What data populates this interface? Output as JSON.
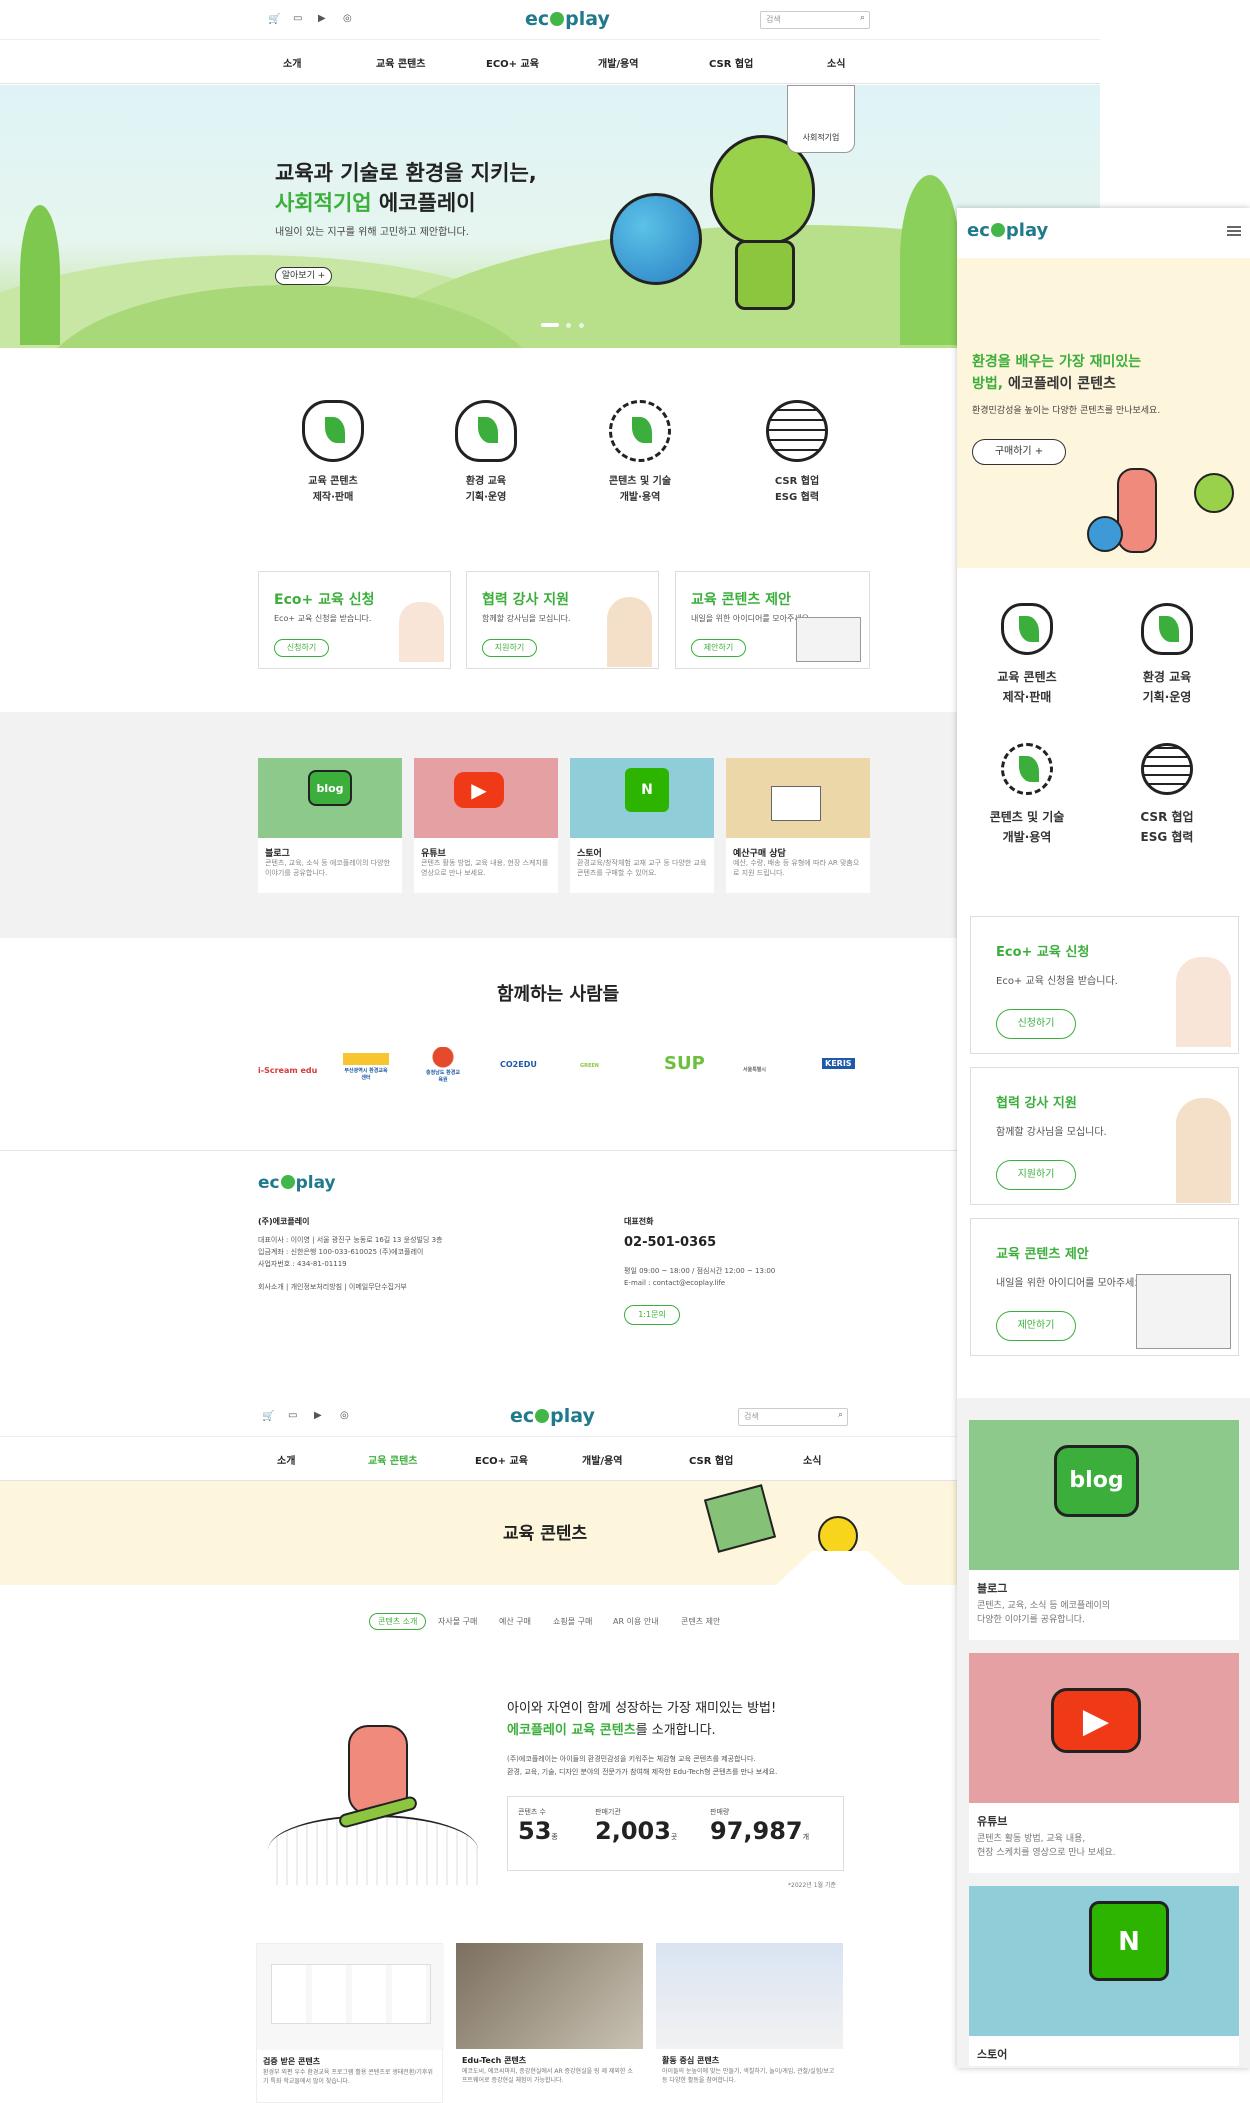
{
  "desktop": {
    "search_placeholder": "검색",
    "logo": "ecoplay",
    "nav": [
      "소개",
      "교육 콘텐츠",
      "ECO+ 교육",
      "개발/용역",
      "CSR 협업",
      "소식"
    ],
    "hero": {
      "title_line1": "교육과 기술로 환경을 지키는,",
      "title_green": "사회적기업",
      "title_rest": " 에코플레이",
      "subtitle": "내일이 있는 지구를 위해 고민하고 제안합니다.",
      "button": "알아보기 +",
      "badge": "사회적기업"
    },
    "services": [
      {
        "l1": "교육 콘텐츠",
        "l2": "제작·판매"
      },
      {
        "l1": "환경 교육",
        "l2": "기획·운영"
      },
      {
        "l1": "콘텐츠 및 기술",
        "l2": "개발·용역"
      },
      {
        "l1": "CSR 협업",
        "l2": "ESG 협력"
      }
    ],
    "cards": [
      {
        "title": "Eco+ 교육 신청",
        "desc": "Eco+ 교육 신청을 받습니다.",
        "btn": "신청하기"
      },
      {
        "title": "협력 강사 지원",
        "desc": "함께할 강사님을 모십니다.",
        "btn": "지원하기"
      },
      {
        "title": "교육 콘텐츠 제안",
        "desc": "내일을 위한 아이디어를 모아주세요.",
        "btn": "제안하기"
      }
    ],
    "channels": [
      {
        "title": "블로그",
        "desc": "콘텐츠, 교육, 소식 등 에코플레이의 다양한 이야기를 공유합니다."
      },
      {
        "title": "유튜브",
        "desc": "콘텐츠 활동 방법, 교육 내용, 현장 스케치를 영상으로 만나 보세요."
      },
      {
        "title": "스토어",
        "desc": "환경교육/창작체험 교재 교구 등 다양한 교육 콘텐츠를 구매할 수 있어요."
      },
      {
        "title": "예산구매 상담",
        "desc": "예산, 수량, 배송 등 유형에 따라 AR 맞춤으로 지원 드립니다."
      }
    ],
    "partners_title": "함께하는 사람들",
    "partners": [
      "i-Scream edu",
      "부산광역시 환경교육센터",
      "충청남도 환경교육원",
      "CO2EDU",
      "GREEN",
      "SUP",
      "서울특별시",
      "KERIS"
    ],
    "footer": {
      "company": "(주)에코플레이",
      "line1": "대표이사 : 이이영 | 서울 광진구 능동로 16길 13 윤성빌딩 3층",
      "line2": "입금계좌 : 신한은행 100-033-610025 (주)에코플레이",
      "line3": "사업자번호 : 434-81-01119",
      "links": "회사소개 | 개인정보처리방침 | 이메일무단수집거부",
      "phone_label": "대표전화",
      "phone": "02-501-0365",
      "hours": "평일 09:00 ~ 18:00 / 점심시간 12:00 ~ 13:00",
      "email": "E-mail : contact@ecoplay.life",
      "inquiry": "1:1문의"
    }
  },
  "sub": {
    "active_nav": "교육 콘텐츠",
    "banner_title": "교육 콘텐츠",
    "tabs": [
      "콘텐츠 소개",
      "자사몰 구매",
      "예산 구매",
      "쇼핑몰 구매",
      "AR 이용 안내",
      "콘텐츠 제안"
    ],
    "intro_line1": "아이와 자연이 함께 성장하는 가장 재미있는 방법!",
    "intro_green": "에코플레이 교육 콘텐츠",
    "intro_rest": "를 소개합니다.",
    "intro_desc1": "(주)에코플레이는 아이들의 환경민감성을 키워주는 체감형 교육 콘텐츠를 제공합니다.",
    "intro_desc2": "환경, 교육, 기술, 디자인 분야의 전문가가 참여해 제작한 Edu-Tech형 콘텐츠를 만나 보세요.",
    "stats": [
      {
        "label": "콘텐츠 수",
        "value": "53",
        "unit": "종"
      },
      {
        "label": "판매기관",
        "value": "2,003",
        "unit": "곳"
      },
      {
        "label": "판매량",
        "value": "97,987",
        "unit": "개"
      }
    ],
    "stat_note": "*2022년 1월 기준",
    "features": [
      {
        "title": "검증 받은 콘텐츠",
        "desc": "환경부 외편 우수 환경교육 프로그램 활용 콘텐츠로 생태전환/기후위기 특화 학교들에서 많이 찾습니다."
      },
      {
        "title": "Edu-Tech 콘텐츠",
        "desc": "에코도씨, 에코씨마지, 증강현실에서 AR 증강현실을 링 제 제외한 소프트웨어로 증강현실 체험이 가능합니다."
      },
      {
        "title": "활동 중심 콘텐츠",
        "desc": "아이들의 눈높이에 맞는 만들기, 색칠하기, 놀이/게임, 관찰/실험/보고 등 다양한 활동을 참여합니다."
      }
    ]
  },
  "mobile": {
    "hero_line1": "환경을 배우는 가장 재미있는",
    "hero_line2_green": "방법,",
    "hero_line2_rest": " 에코플레이 콘텐츠",
    "hero_desc": "환경민감성을 높이는 다양한 콘텐츠를 만나보세요.",
    "hero_btn": "구매하기 +",
    "services": [
      {
        "l1": "교육 콘텐츠",
        "l2": "제작·판매"
      },
      {
        "l1": "환경 교육",
        "l2": "기획·운영"
      },
      {
        "l1": "콘텐츠 및 기술",
        "l2": "개발·용역"
      },
      {
        "l1": "CSR 협업",
        "l2": "ESG 협력"
      }
    ],
    "cards": [
      {
        "title": "Eco+ 교육 신청",
        "desc": "Eco+ 교육 신청을 받습니다.",
        "btn": "신청하기"
      },
      {
        "title": "협력 강사 지원",
        "desc": "함께할 강사님을 모십니다.",
        "btn": "지원하기"
      },
      {
        "title": "교육 콘텐츠 제안",
        "desc": "내일을 위한 아이디어를 모아주세요.",
        "btn": "제안하기"
      }
    ],
    "channels": [
      {
        "title": "블로그",
        "desc1": "콘텐츠, 교육, 소식 등 에코플레이의",
        "desc2": "다양한 이야기를 공유합니다."
      },
      {
        "title": "유튜브",
        "desc1": "콘텐츠 활동 방법, 교육 내용,",
        "desc2": "현장 스케치를 영상으로 만나 보세요."
      },
      {
        "title": "스토어",
        "desc1": "",
        "desc2": ""
      }
    ]
  },
  "colors": {
    "green": "#3cae3c",
    "teal": "#1f7a8c",
    "grey_bg": "#f2f2f2",
    "cream": "#fdf5dc"
  }
}
